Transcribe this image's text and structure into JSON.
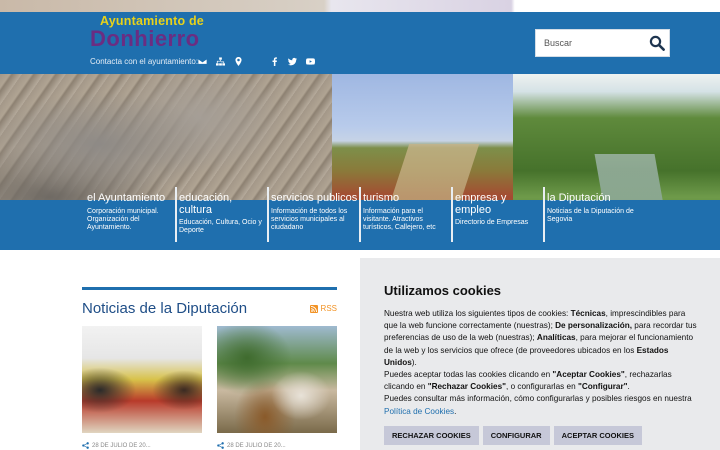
{
  "header": {
    "logo_top": "Ayuntamiento de",
    "logo_main": "Donhierro",
    "contact_label": "Contacta con el ayuntamiento:",
    "contact_icons": [
      "envelope-icon",
      "sitemap-icon",
      "map-marker-icon",
      "facebook-icon",
      "twitter-icon",
      "youtube-icon"
    ],
    "search": {
      "placeholder": "Buscar"
    }
  },
  "nav": [
    {
      "title": "el Ayuntamiento",
      "desc": "Corporación municipal. Organización del Ayuntamiento."
    },
    {
      "title": "educación, cultura",
      "desc": "Educación, Cultura, Ocio y Deporte"
    },
    {
      "title": "servicios publicos",
      "desc": "Información de todos los servicios municipales al ciudadano"
    },
    {
      "title": "turismo",
      "desc": "Información para el visitante. Atractivos turísticos, Callejero, etc"
    },
    {
      "title": "empresa y empleo",
      "desc": "Directorio de Empresas"
    },
    {
      "title": "la Diputación",
      "desc": "Noticias de la Diputación de Segovia"
    }
  ],
  "news": {
    "title": "Noticias de la Diputación",
    "rss_label": "RSS",
    "cards": [
      {
        "date": "28 DE JULIO DE 20..."
      },
      {
        "date": "28 DE JULIO DE 20..."
      }
    ]
  },
  "cookies": {
    "title": "Utilizamos cookies",
    "p1_a": "Nuestra web utiliza los siguientes tipos de cookies: ",
    "p1_b": "Técnicas",
    "p1_c": ", imprescindibles para que la web funcione correctamente (nuestras); ",
    "p1_d": "De personalización,",
    "p1_e": " para recordar tus preferencias de uso de la web (nuestras); ",
    "p1_f": "Analíticas",
    "p1_g": ", para mejorar el funcionamiento de la web y los servicios que ofrece (de proveedores ubicados en los ",
    "p1_h": "Estados Unidos",
    "p1_i": ").",
    "p2_a": "Puedes aceptar todas las cookies clicando en ",
    "p2_b": "\"Aceptar Cookies\"",
    "p2_c": ", rechazarlas clicando en ",
    "p2_d": "\"Rechazar Cookies\"",
    "p2_e": ", o configurarlas en ",
    "p2_f": "\"Configurar\"",
    "p2_g": ".",
    "p3": "Puedes consultar más información, cómo configurarlas y posibles riesgos en nuestra ",
    "policy_link": "Política de Cookies",
    "p3_end": ".",
    "btn_reject": "RECHAZAR COOKIES",
    "btn_configure": "CONFIGURAR",
    "btn_accept": "ACEPTAR COOKIES"
  },
  "colors": {
    "primary_blue": "#1f6fae",
    "logo_yellow": "#e8d21a",
    "logo_purple": "#6b2d82",
    "rss_orange": "#f29325",
    "cookie_bg": "#e9eaec",
    "cookie_button": "#c6c8d8"
  }
}
